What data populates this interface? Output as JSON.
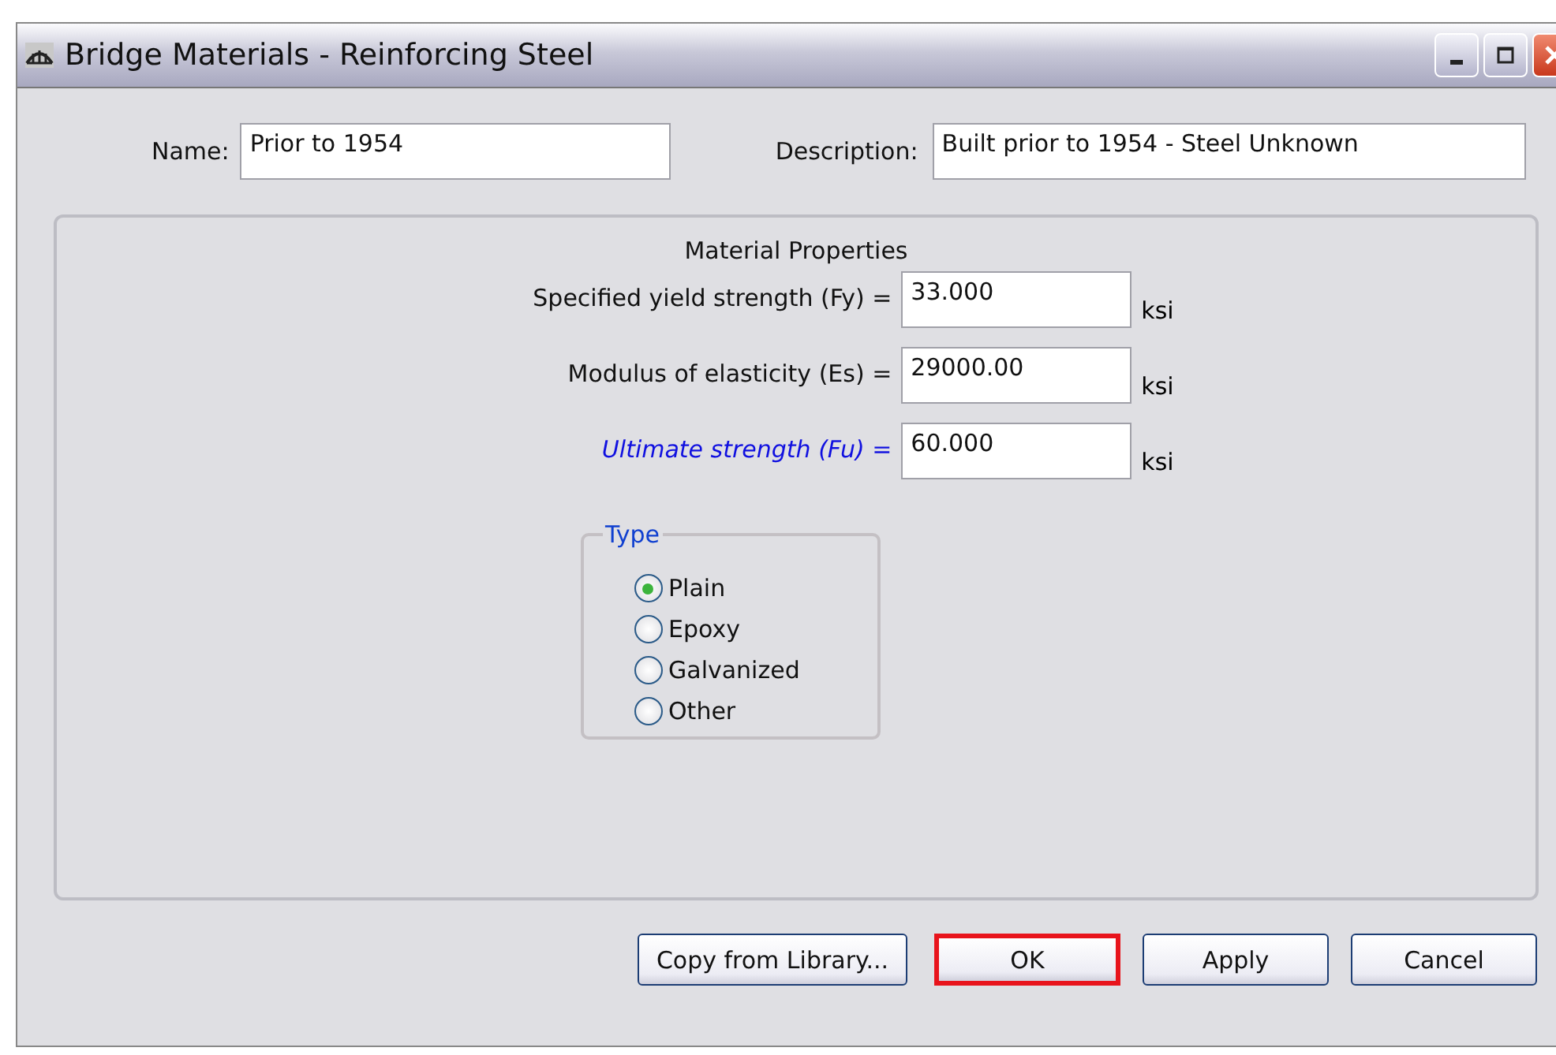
{
  "window": {
    "title": "Bridge Materials - Reinforcing Steel"
  },
  "name": {
    "label": "Name:",
    "value": "Prior to 1954"
  },
  "description": {
    "label": "Description:",
    "value": "Built prior to 1954 - Steel Unknown"
  },
  "material_properties": {
    "title": "Material Properties",
    "rows": [
      {
        "label": "Specified yield strength (Fy) =",
        "value": "33.000",
        "unit": "ksi",
        "emphasis": false
      },
      {
        "label": "Modulus of elasticity (Es) =",
        "value": "29000.00",
        "unit": "ksi",
        "emphasis": false
      },
      {
        "label": "Ultimate strength (Fu) =",
        "value": "60.000",
        "unit": "ksi",
        "emphasis": true
      }
    ]
  },
  "type": {
    "title": "Type",
    "options": [
      {
        "label": "Plain",
        "selected": true
      },
      {
        "label": "Epoxy",
        "selected": false
      },
      {
        "label": "Galvanized",
        "selected": false
      },
      {
        "label": "Other",
        "selected": false
      }
    ]
  },
  "buttons": [
    {
      "label": "Copy from Library...",
      "highlighted": false
    },
    {
      "label": "OK",
      "highlighted": true
    },
    {
      "label": "Apply",
      "highlighted": false
    },
    {
      "label": "Cancel",
      "highlighted": false
    }
  ]
}
